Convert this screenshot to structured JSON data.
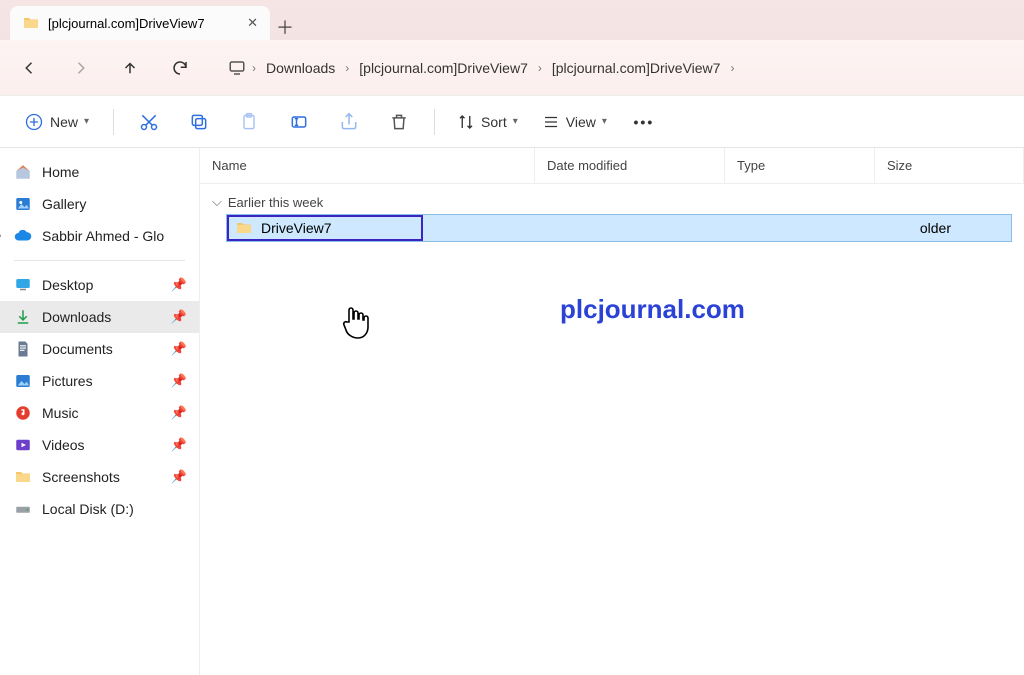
{
  "tab": {
    "title": "[plcjournal.com]DriveView7"
  },
  "breadcrumbs": [
    "Downloads",
    "[plcjournal.com]DriveView7",
    "[plcjournal.com]DriveView7"
  ],
  "toolbar": {
    "new": "New",
    "sort": "Sort",
    "view": "View"
  },
  "sidebar": {
    "home": "Home",
    "gallery": "Gallery",
    "onedrive": "Sabbir Ahmed - Glo",
    "quick": {
      "desktop": "Desktop",
      "downloads": "Downloads",
      "documents": "Documents",
      "pictures": "Pictures",
      "music": "Music",
      "videos": "Videos",
      "screenshots": "Screenshots",
      "localdisk": "Local Disk (D:)"
    }
  },
  "columns": {
    "name": "Name",
    "date": "Date modified",
    "type": "Type",
    "size": "Size"
  },
  "group_label": "Earlier this week",
  "rows": [
    {
      "name": "DriveView7",
      "type_suffix": "older"
    }
  ],
  "watermark": "plcjournal.com"
}
